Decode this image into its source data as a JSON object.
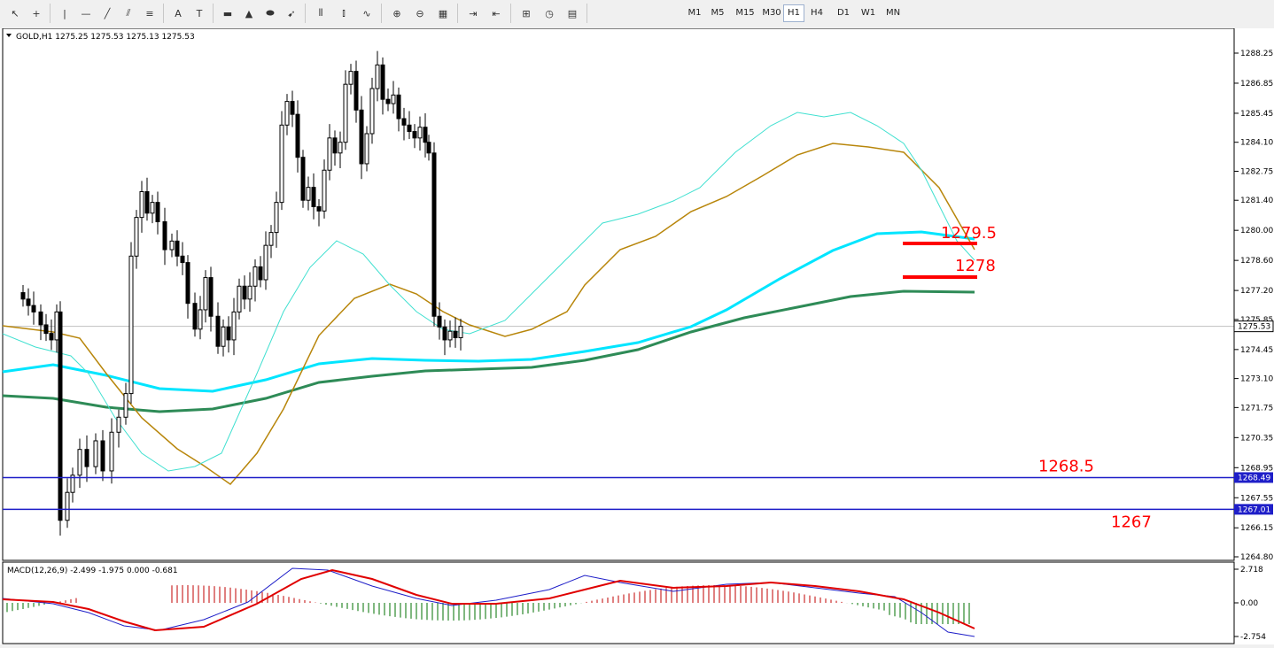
{
  "toolbar": {
    "tools": [
      {
        "name": "cursor-icon",
        "glyph": "↖"
      },
      {
        "name": "crosshair-icon",
        "glyph": "+"
      },
      {
        "name": "vertical-line-icon",
        "glyph": "|"
      },
      {
        "name": "horizontal-line-icon",
        "glyph": "—"
      },
      {
        "name": "trendline-icon",
        "glyph": "╱"
      },
      {
        "name": "equidistant-channel-icon",
        "glyph": "⫽"
      },
      {
        "name": "fibonacci-icon",
        "glyph": "≡"
      },
      {
        "name": "text-icon",
        "glyph": "A"
      },
      {
        "name": "text-label-icon",
        "glyph": "T"
      },
      {
        "name": "rectangle-icon",
        "glyph": "▬"
      },
      {
        "name": "triangle-icon",
        "glyph": "▲"
      },
      {
        "name": "ellipse-icon",
        "glyph": "⬬"
      },
      {
        "name": "arrows-icon",
        "glyph": "➹"
      }
    ],
    "chart_types": [
      {
        "name": "bar-chart-icon",
        "glyph": "⫴"
      },
      {
        "name": "candlestick-icon",
        "glyph": "⫾"
      },
      {
        "name": "line-chart-icon",
        "glyph": "∿"
      }
    ],
    "view_tools": [
      {
        "name": "zoom-in-icon",
        "glyph": "⊕"
      },
      {
        "name": "zoom-out-icon",
        "glyph": "⊖"
      },
      {
        "name": "tile-windows-icon",
        "glyph": "▦"
      },
      {
        "name": "autoscroll-icon",
        "glyph": "⇥"
      },
      {
        "name": "chart-shift-icon",
        "glyph": "⇤"
      },
      {
        "name": "indicators-icon",
        "glyph": "⊞"
      },
      {
        "name": "periods-icon",
        "glyph": "◷"
      },
      {
        "name": "templates-icon",
        "glyph": "▤"
      }
    ],
    "timeframes": [
      "M1",
      "M5",
      "M15",
      "M30",
      "H1",
      "H4",
      "D1",
      "W1",
      "MN"
    ],
    "active_timeframe": "H1"
  },
  "chart": {
    "header": "GOLD,H1  1275.25 1275.53 1275.13 1275.53",
    "current_price": "1275.53",
    "price_ticks": [
      "1288.25",
      "1286.85",
      "1285.45",
      "1284.10",
      "1282.75",
      "1281.40",
      "1280.00",
      "1278.60",
      "1277.20",
      "1275.85",
      "1274.45",
      "1273.10",
      "1271.75",
      "1270.35",
      "1268.95",
      "1267.55",
      "1266.15",
      "1264.80"
    ],
    "hlines": [
      {
        "value": "1268.49",
        "label": "1268.5"
      },
      {
        "value": "1267.01",
        "label": "1267"
      }
    ],
    "resistance_markers": [
      {
        "label": "1279.5"
      },
      {
        "label": "1278"
      }
    ],
    "colors": {
      "candle_up": "#ffffff",
      "candle_down": "#000000",
      "ma_fast": "#40e0d0",
      "ma_mid": "#b8860b",
      "ma_slow": "#00e5ff",
      "ma_long": "#2e8b57",
      "hline": "#1e1ec8",
      "marker": "#ff0000"
    }
  },
  "macd": {
    "header": "MACD(12,26,9) -2.499 -1.975 0.000 -0.681",
    "ticks": [
      "2.718",
      "0.00",
      "-2.754"
    ],
    "colors": {
      "main": "#1e1ec8",
      "signal": "#e00000",
      "hist_pos": "#c00000",
      "hist_neg": "#007000"
    }
  }
}
